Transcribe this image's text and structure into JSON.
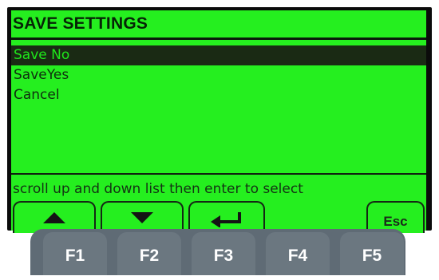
{
  "screen": {
    "title": "SAVE SETTINGS",
    "menu_items": [
      {
        "label": "Save No",
        "selected": true
      },
      {
        "label": "SaveYes",
        "selected": false
      },
      {
        "label": "Cancel",
        "selected": false
      }
    ],
    "status_text": "scroll up and down list then enter to select"
  },
  "softkeys": [
    {
      "icon": "arrow-up-icon"
    },
    {
      "icon": "arrow-down-icon"
    },
    {
      "icon": "enter-icon"
    },
    {
      "label": "Esc"
    }
  ],
  "function_keys": [
    "F1",
    "F2",
    "F3",
    "F4",
    "F5"
  ],
  "colors": {
    "lcd_background": "#25ef1f",
    "lcd_text": "#0f2e0f",
    "selection_background": "#1a2a14",
    "key_background": "#6b7780"
  }
}
